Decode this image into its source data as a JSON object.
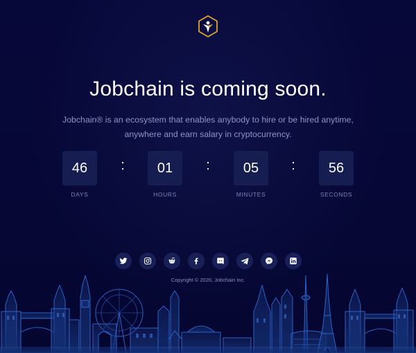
{
  "brand": {
    "logo_icon": "star-hexagon-logo-icon",
    "logo_color": "#e0a531"
  },
  "hero": {
    "title": "Jobchain is coming soon.",
    "subtitle": "Jobchain® is an ecosystem that enables anybody to hire or be hired anytime, anywhere and earn salary in cryptocurrency."
  },
  "countdown": {
    "separator": ":",
    "units": [
      {
        "value": "46",
        "label": "DAYS"
      },
      {
        "value": "01",
        "label": "HOURS"
      },
      {
        "value": "05",
        "label": "MINUTES"
      },
      {
        "value": "56",
        "label": "SECONDS"
      }
    ]
  },
  "socials": [
    {
      "icon": "twitter-icon"
    },
    {
      "icon": "instagram-icon"
    },
    {
      "icon": "reddit-icon"
    },
    {
      "icon": "facebook-icon"
    },
    {
      "icon": "discord-icon"
    },
    {
      "icon": "telegram-icon"
    },
    {
      "icon": "messenger-icon"
    },
    {
      "icon": "linkedin-icon"
    }
  ],
  "footer": {
    "copyright": "Copyright © 2020, Jobchain Inc."
  },
  "colors": {
    "background": "#07093a",
    "box": "#161d50",
    "accent": "#e0a531",
    "skyline": "#2d63c8"
  }
}
